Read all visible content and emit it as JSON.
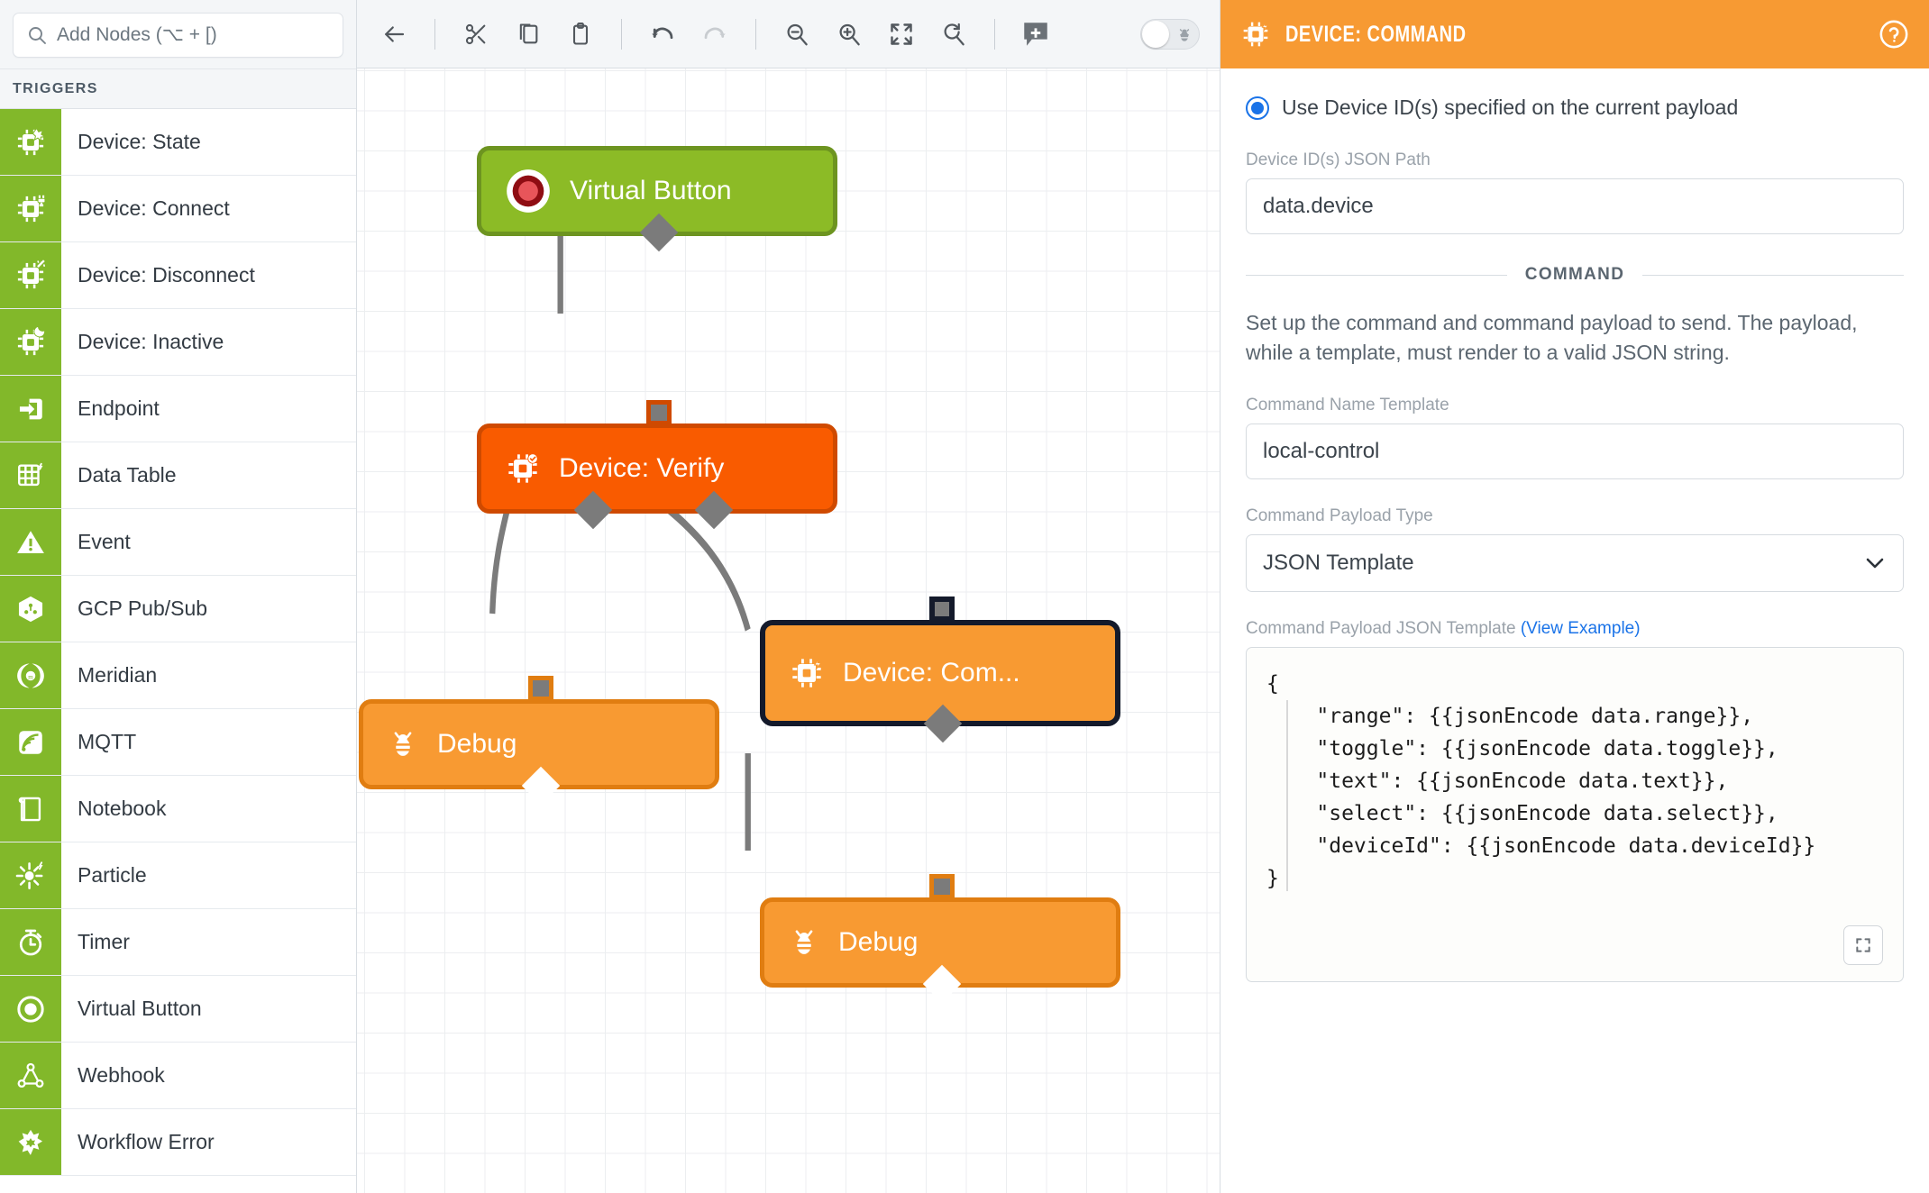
{
  "left_panel": {
    "search": {
      "placeholder": "Add Nodes (⌥ + [)",
      "value": ""
    },
    "section_title": "TRIGGERS",
    "items": [
      {
        "label": "Device: State",
        "icon": "chip-state-icon"
      },
      {
        "label": "Device: Connect",
        "icon": "chip-connect-icon"
      },
      {
        "label": "Device: Disconnect",
        "icon": "chip-disconnect-icon"
      },
      {
        "label": "Device: Inactive",
        "icon": "chip-moon-icon"
      },
      {
        "label": "Endpoint",
        "icon": "endpoint-icon"
      },
      {
        "label": "Data Table",
        "icon": "data-table-icon"
      },
      {
        "label": "Event",
        "icon": "warning-triangle-icon"
      },
      {
        "label": "GCP Pub/Sub",
        "icon": "gcp-pubsub-icon"
      },
      {
        "label": "Meridian",
        "icon": "meridian-icon"
      },
      {
        "label": "MQTT",
        "icon": "mqtt-icon"
      },
      {
        "label": "Notebook",
        "icon": "notebook-icon"
      },
      {
        "label": "Particle",
        "icon": "particle-icon"
      },
      {
        "label": "Timer",
        "icon": "timer-icon"
      },
      {
        "label": "Virtual Button",
        "icon": "virtual-button-icon"
      },
      {
        "label": "Webhook",
        "icon": "webhook-icon"
      },
      {
        "label": "Workflow Error",
        "icon": "workflow-error-icon"
      }
    ]
  },
  "toolbar": {
    "buttons": [
      {
        "name": "back-icon",
        "title": "Back"
      },
      {
        "name": "cut-icon",
        "title": "Cut"
      },
      {
        "name": "copy-icon",
        "title": "Copy"
      },
      {
        "name": "paste-icon",
        "title": "Paste"
      },
      {
        "name": "undo-icon",
        "title": "Undo"
      },
      {
        "name": "redo-icon",
        "title": "Redo"
      },
      {
        "name": "zoom-out-icon",
        "title": "Zoom Out"
      },
      {
        "name": "zoom-in-icon",
        "title": "Zoom In"
      },
      {
        "name": "fit-screen-icon",
        "title": "Fit to Screen"
      },
      {
        "name": "zoom-reset-icon",
        "title": "Reset Zoom"
      },
      {
        "name": "add-comment-icon",
        "title": "Add Comment"
      }
    ],
    "debug_toggle": {
      "state": "off",
      "icon": "bug-icon"
    }
  },
  "canvas": {
    "nodes": [
      {
        "id": "virtual-button",
        "label": "Virtual Button",
        "icon": "virtual-button-node-icon",
        "type": "trigger"
      },
      {
        "id": "device-verify",
        "label": "Device: Verify",
        "icon": "chip-verify-icon",
        "type": "verify"
      },
      {
        "id": "device-command",
        "label": "Device: Com...",
        "icon": "chip-command-icon",
        "type": "command",
        "selected": true
      },
      {
        "id": "debug-left",
        "label": "Debug",
        "icon": "bug-node-icon",
        "type": "debug"
      },
      {
        "id": "debug-right",
        "label": "Debug",
        "icon": "bug-node-icon",
        "type": "debug"
      }
    ]
  },
  "right_panel": {
    "header": {
      "title": "DEVICE: COMMAND",
      "icon": "chip-command-icon",
      "help_icon": "help-circle-icon"
    },
    "device_id_option": {
      "label": "Use Device ID(s) specified on the current payload",
      "selected": true
    },
    "device_id_path": {
      "label": "Device ID(s) JSON Path",
      "value": "data.device"
    },
    "section_divider": "COMMAND",
    "description": "Set up the command and command payload to send. The payload, while a template, must render to a valid JSON string.",
    "command_name": {
      "label": "Command Name Template",
      "value": "local-control"
    },
    "payload_type": {
      "label": "Command Payload Type",
      "value": "JSON Template"
    },
    "payload_template": {
      "label": "Command Payload JSON Template",
      "link": "(View Example)",
      "code": "{\n    \"range\": {{jsonEncode data.range}},\n    \"toggle\": {{jsonEncode data.toggle}},\n    \"text\": {{jsonEncode data.text}},\n    \"select\": {{jsonEncode data.select}},\n    \"deviceId\": {{jsonEncode data.deviceId}}\n}",
      "expand_icon": "expand-icon"
    }
  },
  "colors": {
    "trigger_green": "#8cbb26",
    "verify_orange": "#f95b00",
    "action_orange": "#f89a32",
    "panel_header": "#f79a33",
    "accent_blue": "#1a73e8",
    "selection_dark": "#141a2b"
  }
}
